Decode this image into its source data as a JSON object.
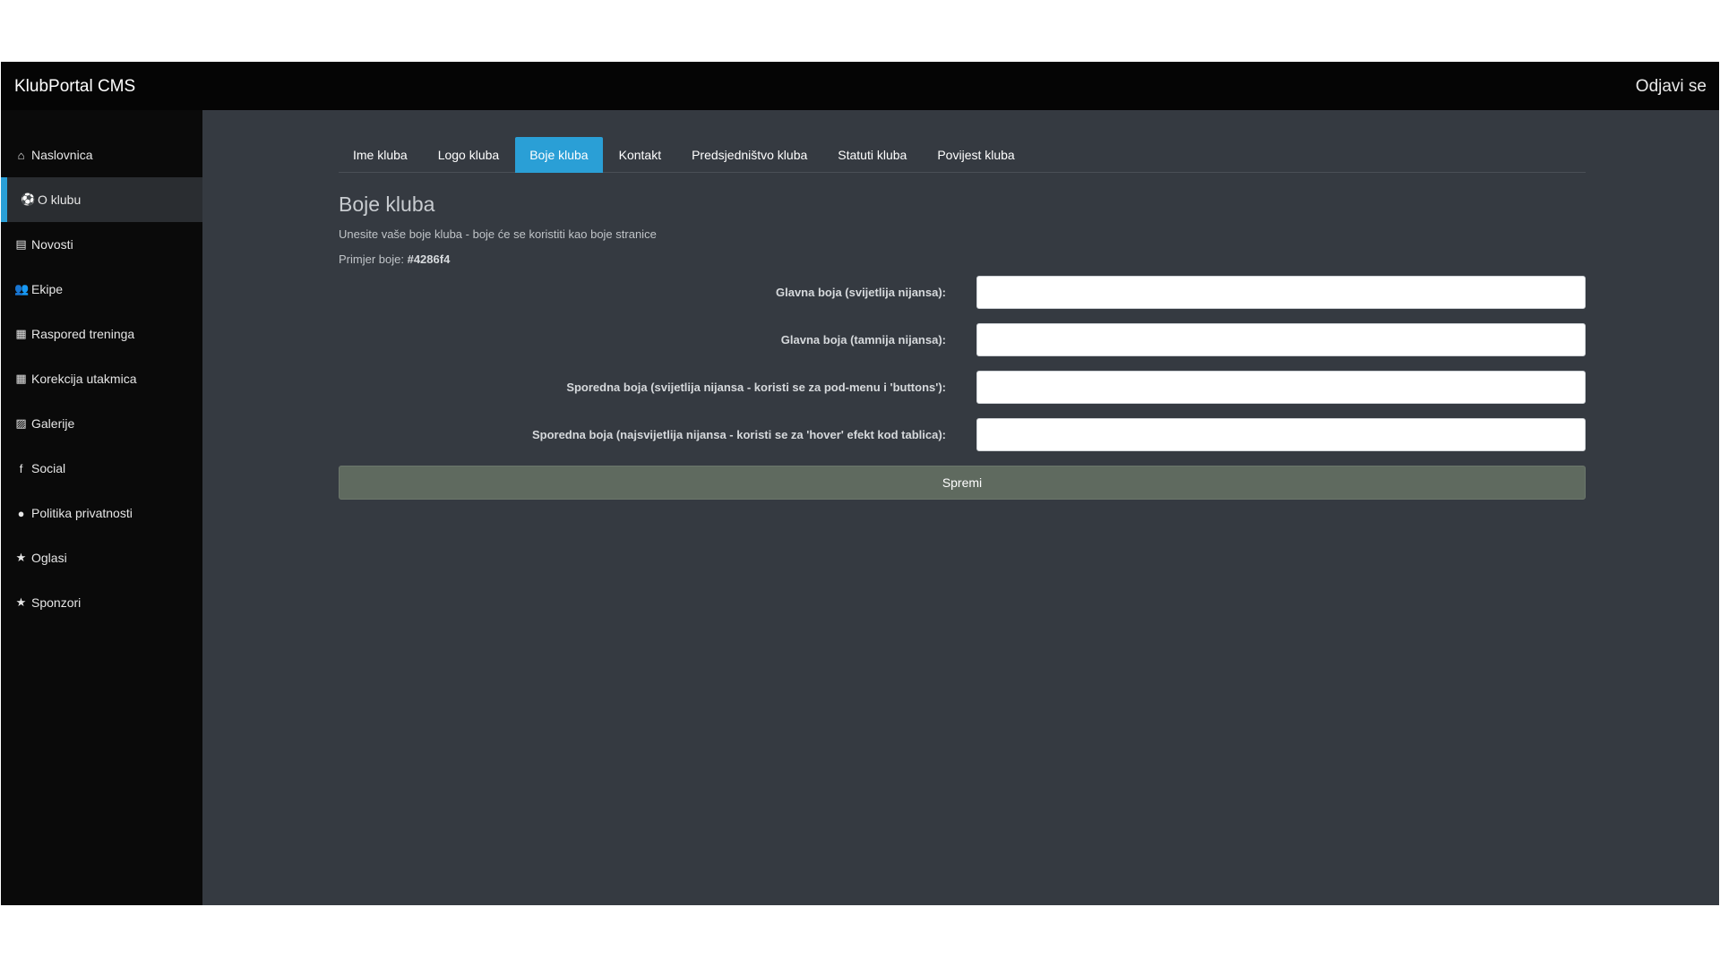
{
  "header": {
    "brand": "KlubPortal CMS",
    "logout_label": "Odjavi se"
  },
  "sidebar": {
    "items": [
      {
        "label": "Naslovnica",
        "icon": "home-icon",
        "glyph": "⌂"
      },
      {
        "label": "O klubu",
        "icon": "soccer-ball-icon",
        "glyph": "⚽",
        "active": true
      },
      {
        "label": "Novosti",
        "icon": "file-icon",
        "glyph": "▤"
      },
      {
        "label": "Ekipe",
        "icon": "users-icon",
        "glyph": "👥"
      },
      {
        "label": "Raspored treninga",
        "icon": "calendar-icon",
        "glyph": "▦"
      },
      {
        "label": "Korekcija utakmica",
        "icon": "calendar-icon",
        "glyph": "▦"
      },
      {
        "label": "Galerije",
        "icon": "images-icon",
        "glyph": "▨"
      },
      {
        "label": "Social",
        "icon": "facebook-icon",
        "glyph": "f"
      },
      {
        "label": "Politika privatnosti",
        "icon": "cookie-icon",
        "glyph": "●"
      },
      {
        "label": "Oglasi",
        "icon": "star-icon",
        "glyph": "★"
      },
      {
        "label": "Sponzori",
        "icon": "star-icon",
        "glyph": "★"
      }
    ]
  },
  "tabs": [
    {
      "label": "Ime kluba"
    },
    {
      "label": "Logo kluba"
    },
    {
      "label": "Boje kluba",
      "active": true
    },
    {
      "label": "Kontakt"
    },
    {
      "label": "Predsjedništvo kluba"
    },
    {
      "label": "Statuti kluba"
    },
    {
      "label": "Povijest kluba"
    }
  ],
  "content": {
    "title": "Boje kluba",
    "description": "Unesite vaše boje kluba - boje će se koristiti kao boje stranice",
    "example_label": "Primjer boje:",
    "example_value": "#4286f4"
  },
  "fields": [
    {
      "label": "Glavna boja (svijetlija nijansa):",
      "value": ""
    },
    {
      "label": "Glavna boja (tamnija nijansa):",
      "value": ""
    },
    {
      "label": "Sporedna boja (svijetlija nijansa - koristi se za pod-menu i 'buttons'):",
      "value": ""
    },
    {
      "label": "Sporedna boja (najsvijetlija nijansa - koristi se za 'hover' efekt kod tablica):",
      "value": ""
    }
  ],
  "save_label": "Spremi",
  "colors": {
    "accent": "#2a9fd6",
    "topbar": "#050505",
    "sidebar": "#0a0a0a",
    "content_bg": "#353a41",
    "save_button": "#5f6a5f"
  }
}
